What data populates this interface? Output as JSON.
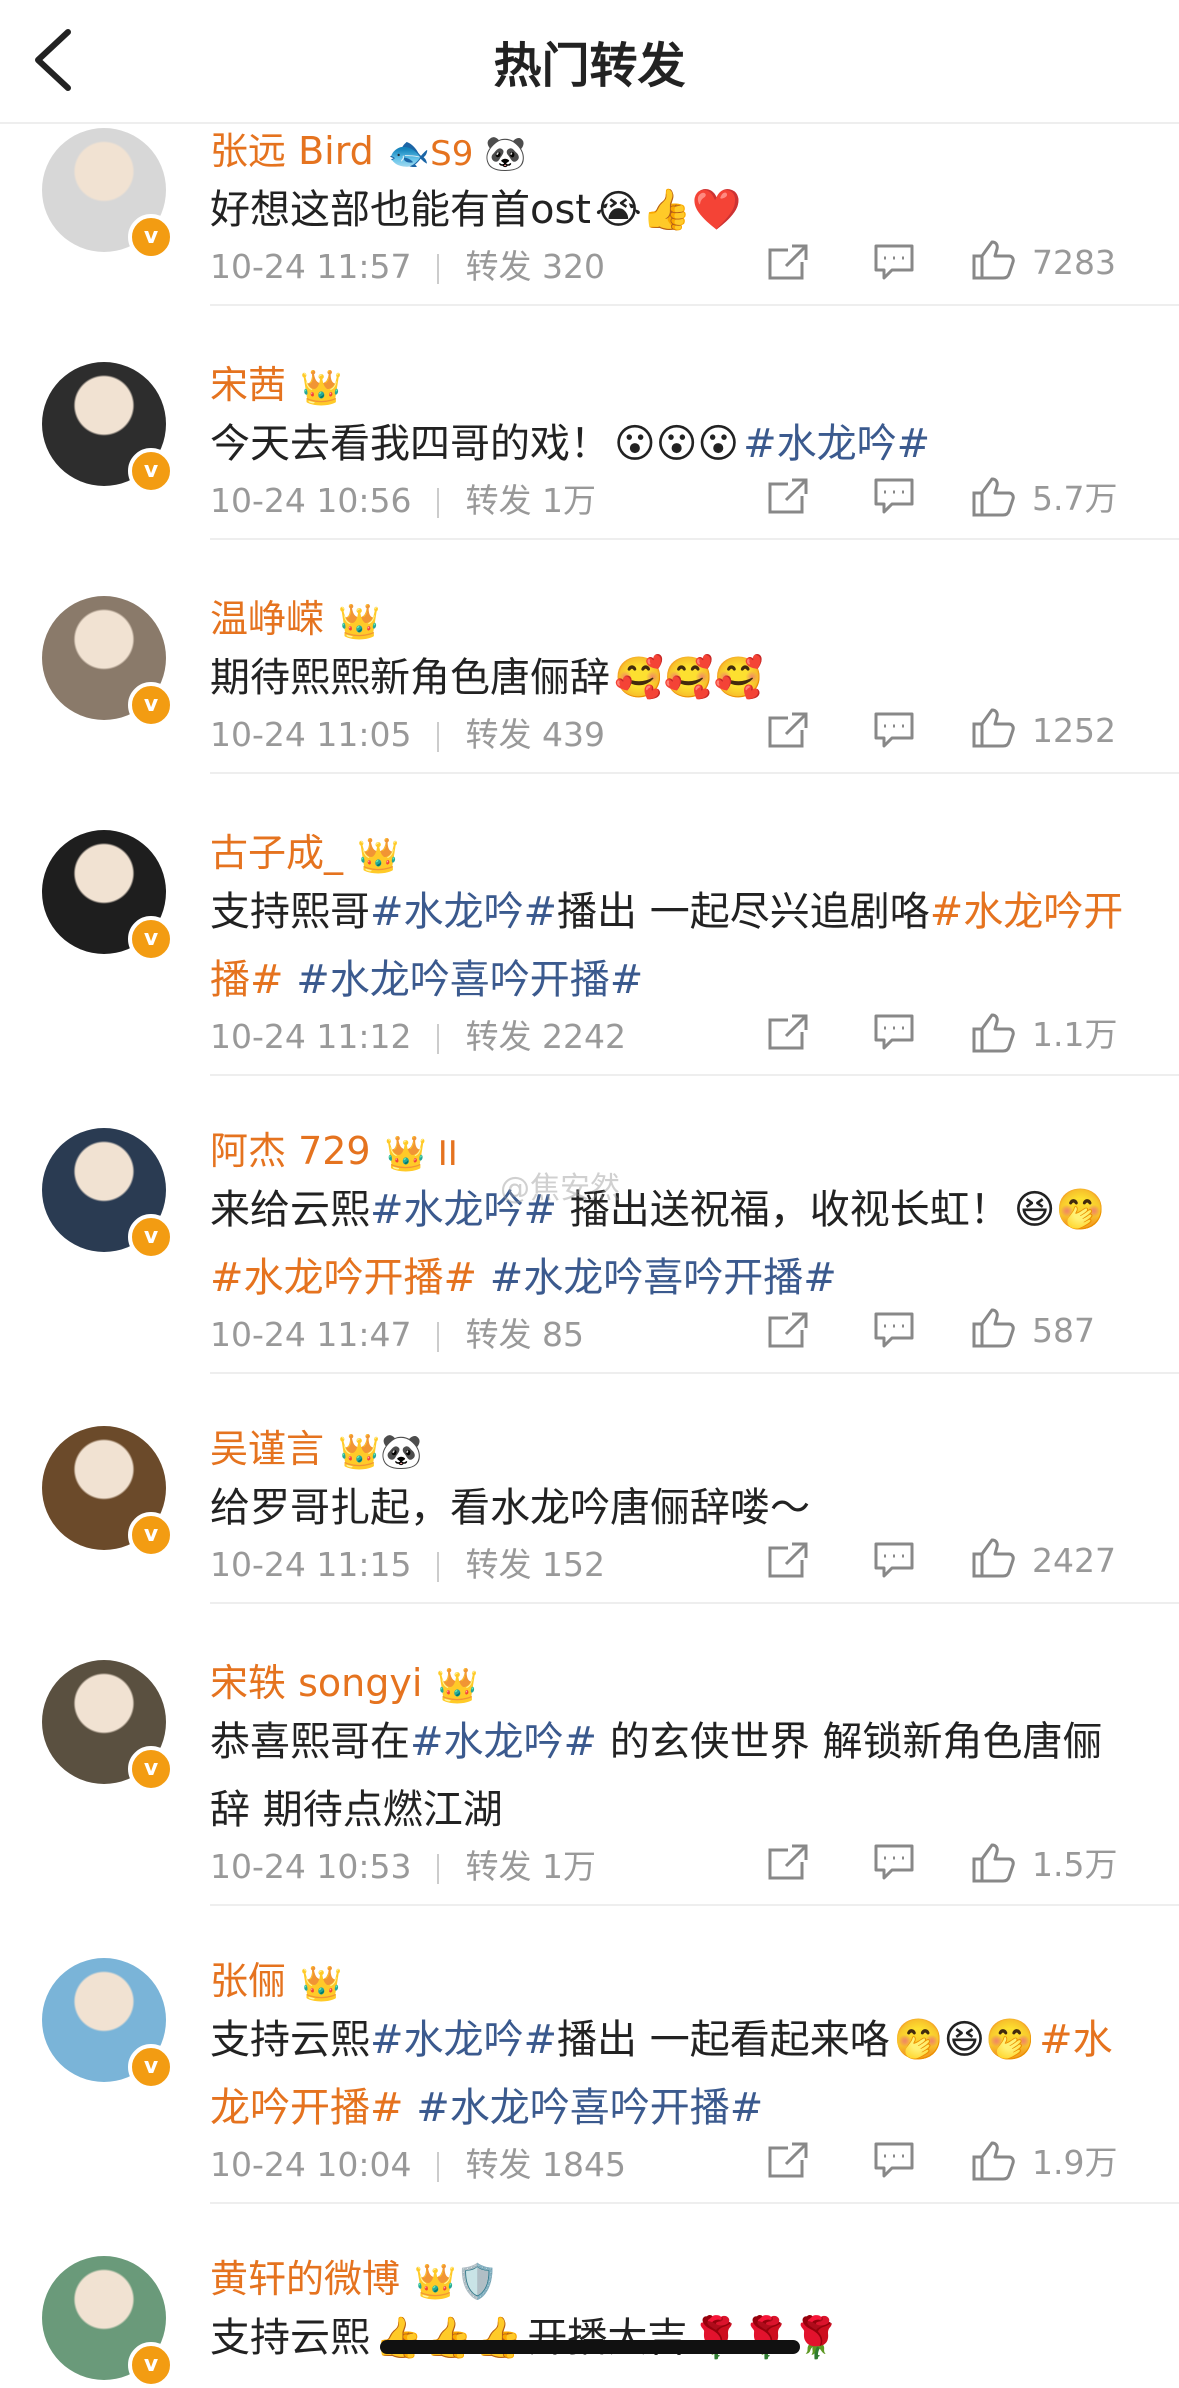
{
  "header": {
    "title": "热门转发"
  },
  "watermark": "@焦安然",
  "items": [
    {
      "name": "张远 Bird",
      "badge": "🐟S9 🐼",
      "avatar_color": "#d7d7d7",
      "segments": [
        {
          "t": "text",
          "v": "好想这部也能有首ost"
        },
        {
          "t": "emoji",
          "v": "😭👍❤️"
        }
      ],
      "date": "10-24 11:57",
      "repost": "转发 320",
      "likes": "7283"
    },
    {
      "name": "宋茜",
      "badge": "👑",
      "avatar_color": "#2d2d2d",
      "segments": [
        {
          "t": "text",
          "v": "今天去看我四哥的戏！"
        },
        {
          "t": "emoji",
          "v": "😮😮😮"
        },
        {
          "t": "tag",
          "v": "#水龙吟#"
        }
      ],
      "date": "10-24 10:56",
      "repost": "转发 1万",
      "likes": "5.7万"
    },
    {
      "name": "温峥嵘",
      "badge": "👑",
      "avatar_color": "#8a7a6a",
      "segments": [
        {
          "t": "text",
          "v": "期待熙熙新角色唐俪辞"
        },
        {
          "t": "emoji",
          "v": "🥰🥰🥰"
        }
      ],
      "date": "10-24 11:05",
      "repost": "转发 439",
      "likes": "1252"
    },
    {
      "name": "古子成_",
      "badge": "👑",
      "avatar_color": "#1e1e1e",
      "segments": [
        {
          "t": "text",
          "v": "支持熙哥"
        },
        {
          "t": "tag",
          "v": "#水龙吟#"
        },
        {
          "t": "text",
          "v": "播出 一起尽兴追剧咯"
        },
        {
          "t": "tago",
          "v": "#水龙吟开播#"
        },
        {
          "t": "text",
          "v": " "
        },
        {
          "t": "tag",
          "v": "#水龙吟喜吟开播#"
        }
      ],
      "date": "10-24 11:12",
      "repost": "转发 2242",
      "likes": "1.1万"
    },
    {
      "name": "阿杰 729",
      "badge": "👑 II",
      "avatar_color": "#2a3b52",
      "segments": [
        {
          "t": "text",
          "v": "来给云熙"
        },
        {
          "t": "tag",
          "v": "#水龙吟#"
        },
        {
          "t": "text",
          "v": " 播出送祝福，收视长虹！"
        },
        {
          "t": "emoji",
          "v": "😆🤭"
        },
        {
          "t": "tago",
          "v": "#水龙吟开播#"
        },
        {
          "t": "text",
          "v": " "
        },
        {
          "t": "tag",
          "v": "#水龙吟喜吟开播#"
        }
      ],
      "date": "10-24 11:47",
      "repost": "转发 85",
      "likes": "587"
    },
    {
      "name": "吴谨言",
      "badge": "👑🐼",
      "avatar_color": "#6b4a2a",
      "segments": [
        {
          "t": "text",
          "v": "给罗哥扎起，看水龙吟唐俪辞喽～"
        }
      ],
      "date": "10-24 11:15",
      "repost": "转发 152",
      "likes": "2427"
    },
    {
      "name": "宋轶 songyi",
      "badge": "👑",
      "avatar_color": "#5a5040",
      "segments": [
        {
          "t": "text",
          "v": "恭喜熙哥在"
        },
        {
          "t": "tag",
          "v": "#水龙吟#"
        },
        {
          "t": "text",
          "v": " 的玄侠世界 解锁新角色唐俪辞 期待点燃江湖"
        }
      ],
      "date": "10-24 10:53",
      "repost": "转发 1万",
      "likes": "1.5万"
    },
    {
      "name": "张俪",
      "badge": "👑",
      "avatar_color": "#7ab4d8",
      "segments": [
        {
          "t": "text",
          "v": "支持云熙"
        },
        {
          "t": "tag",
          "v": "#水龙吟#"
        },
        {
          "t": "text",
          "v": "播出 一起看起来咯"
        },
        {
          "t": "emoji",
          "v": "🤭😆🤭"
        },
        {
          "t": "tago",
          "v": "#水龙吟开播#"
        },
        {
          "t": "text",
          "v": " "
        },
        {
          "t": "tag",
          "v": "#水龙吟喜吟开播#"
        }
      ],
      "date": "10-24 10:04",
      "repost": "转发 1845",
      "likes": "1.9万"
    },
    {
      "name": "黄轩的微博",
      "badge": "👑🛡️",
      "avatar_color": "#6a9a7a",
      "segments": [
        {
          "t": "text",
          "v": "支持云熙"
        },
        {
          "t": "emoji",
          "v": "👍👍👍"
        },
        {
          "t": "text",
          "v": "开播大吉"
        },
        {
          "t": "emoji",
          "v": "🌹🌹🌹"
        }
      ],
      "date": "",
      "repost": "",
      "likes": ""
    }
  ]
}
